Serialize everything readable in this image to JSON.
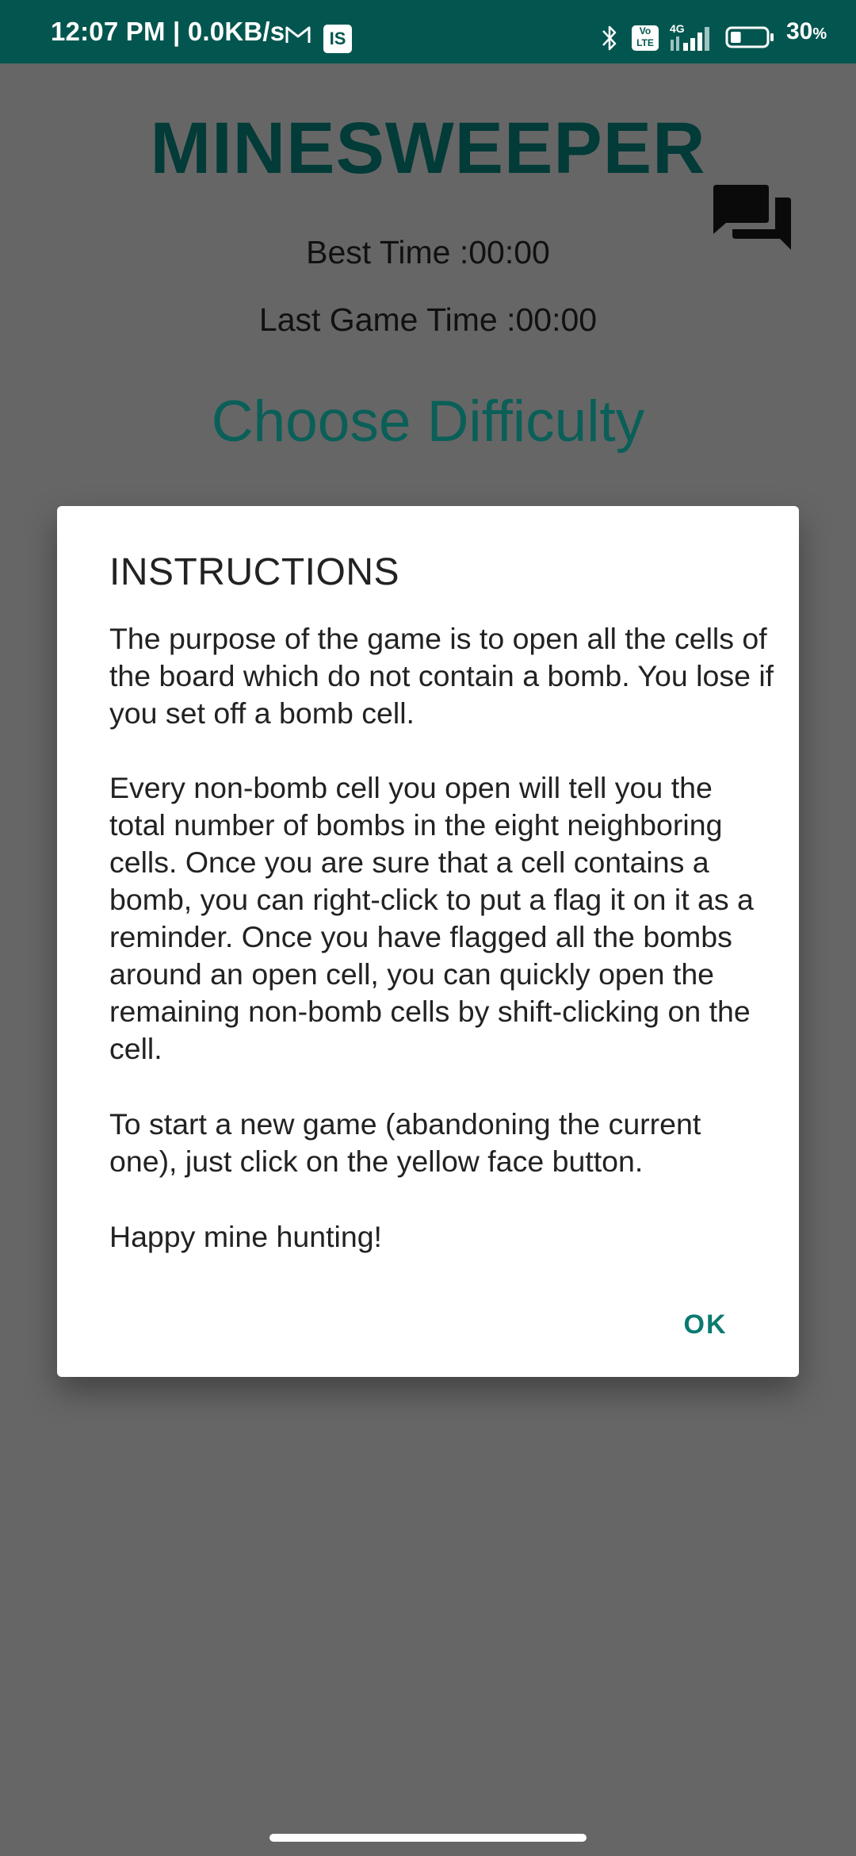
{
  "status_bar": {
    "time_speed": "12:07 PM | 0.0KB/s",
    "app_badge": "IS",
    "volte_label": "Vo LTE",
    "network_label": "4G",
    "battery_percent": "30",
    "battery_unit": "%",
    "battery_level": 0.3
  },
  "app": {
    "title": "MINESWEEPER",
    "best_time": "Best Time :00:00",
    "last_game_time": "Last Game Time :00:00",
    "choose_difficulty": "Choose Difficulty"
  },
  "dialog": {
    "title": "INSTRUCTIONS",
    "paragraphs": [
      "The purpose of the game is to open all the cells of the board which do not contain a bomb. You lose if you set off a bomb cell.",
      "Every non-bomb cell you open will tell you the total number of bombs in the eight neighboring cells. Once you are sure that a cell contains a bomb, you can right-click to put a flag it on it as a reminder. Once you have flagged all the bombs around an open cell, you can quickly open the remaining non-bomb cells by shift-clicking on the cell.",
      "To start a new game (abandoning the current one), just click on the yellow face button.",
      "Happy mine hunting!"
    ],
    "ok_label": "OK"
  },
  "icons": {
    "chat": "chat-bubbles-icon",
    "mail": "gmail-icon",
    "bluetooth": "bluetooth-icon",
    "signal": "signal-icon",
    "battery": "battery-icon"
  },
  "colors": {
    "status_bar": "#03564f",
    "title": "#023b37",
    "accent": "#0a7a70",
    "scrim": "#666666"
  }
}
